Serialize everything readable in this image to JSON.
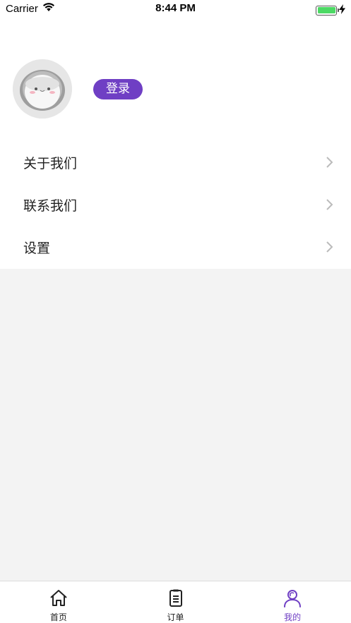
{
  "status_bar": {
    "carrier": "Carrier",
    "time": "8:44 PM",
    "battery_color": "#4cd964"
  },
  "profile": {
    "login_label": "登录",
    "accent_color": "#6f3fc4"
  },
  "menu": {
    "items": [
      {
        "label": "关于我们",
        "icon": "chevron-right-icon"
      },
      {
        "label": "联系我们",
        "icon": "chevron-right-icon"
      },
      {
        "label": "设置",
        "icon": "chevron-right-icon"
      }
    ]
  },
  "tab_bar": {
    "tabs": [
      {
        "label": "首页",
        "icon": "home-icon",
        "active": false
      },
      {
        "label": "订单",
        "icon": "order-list-icon",
        "active": false
      },
      {
        "label": "我的",
        "icon": "user-icon",
        "active": true
      }
    ],
    "active_color": "#6f3fc4",
    "inactive_color": "#222222"
  }
}
